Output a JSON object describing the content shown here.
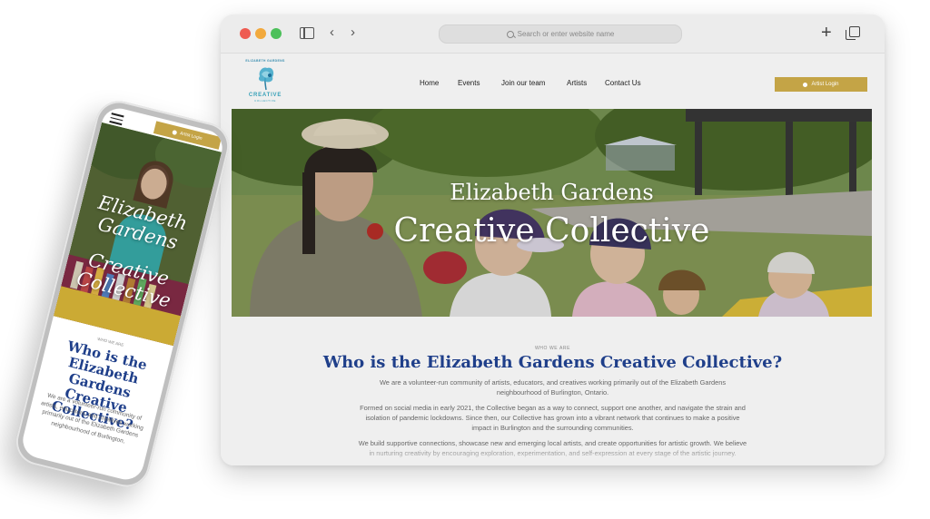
{
  "browser": {
    "address_placeholder": "Search or enter website name"
  },
  "site": {
    "logo": {
      "top_text": "ELIZABETH GARDENS",
      "name": "CREATIVE",
      "sub": "COLLECTIVE"
    },
    "nav": {
      "home": "Home",
      "events": "Events",
      "join": "Join our team",
      "artists": "Artists",
      "contact": "Contact Us"
    },
    "login_label": "Artist Login",
    "hero": {
      "title_line1": "Elizabeth Gardens",
      "title_line2": "Creative Collective"
    },
    "about": {
      "eyebrow": "WHO WE ARE",
      "title": "Who is the Elizabeth Gardens Creative Collective?",
      "p1": "We are a volunteer-run community of artists, educators, and creatives working primarily out of the Elizabeth Gardens neighbourhood of Burlington, Ontario.",
      "p2": "Formed on social media in early 2021, the Collective began as a way to connect, support one another, and navigate the strain and isolation of pandemic lockdowns. Since then, our Collective has grown into a vibrant network that continues to make a positive impact in Burlington and the surrounding communities.",
      "p3": "We build supportive connections, showcase new and emerging local artists, and create opportunities for artistic growth. We believe in nurturing creativity by encouraging exploration, experimentation, and self-expression at every stage of the artistic journey."
    }
  },
  "mobile": {
    "login_label": "Artist Login",
    "hero_line1": "Elizabeth Gardens",
    "hero_line2": "Creative Collective",
    "eyebrow": "WHO WE ARE",
    "title": "Who is the Elizabeth Gardens Creative Collective?",
    "para": "We are a volunteer-run community of artists, educators, and creatives working primarily out of the Elizabeth Gardens neighbourhood of Burlington,"
  },
  "colors": {
    "accent_gold": "#c4a446",
    "heading_blue": "#1f3f8a",
    "logo_teal": "#37a0b8"
  }
}
